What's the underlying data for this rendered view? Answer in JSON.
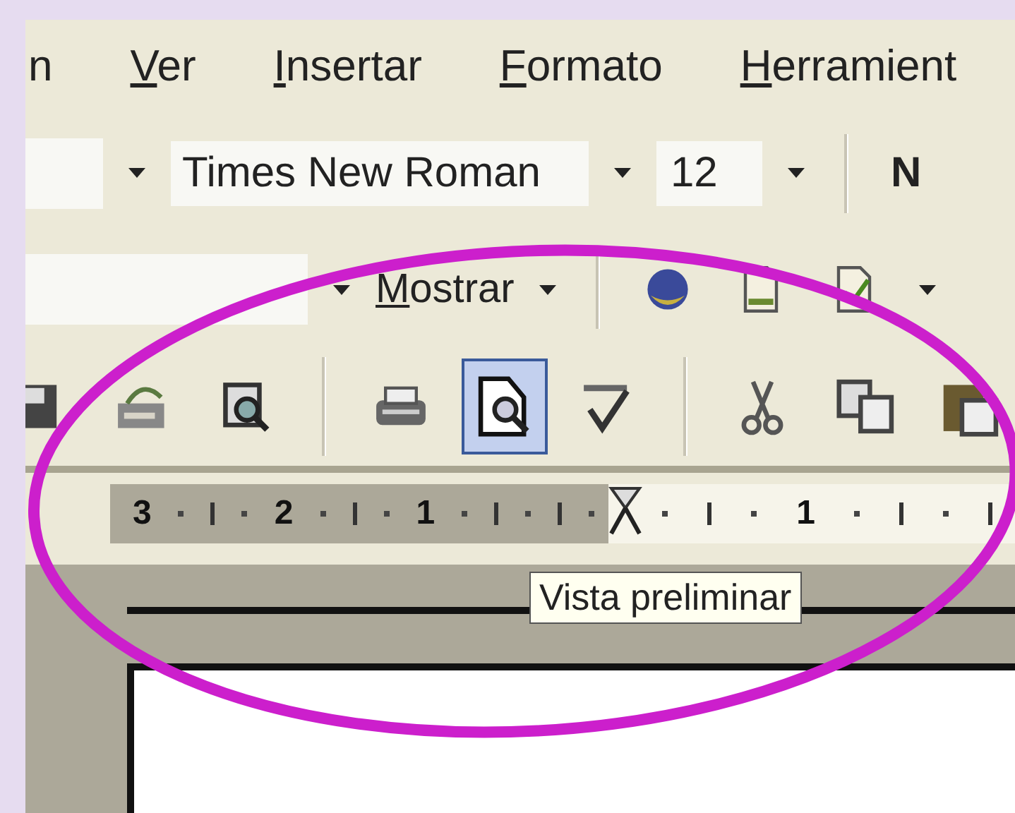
{
  "menu_bar": [
    {
      "rest": "n"
    },
    {
      "accel": "V",
      "rest": "er"
    },
    {
      "accel": "I",
      "rest": "nsertar"
    },
    {
      "accel": "F",
      "rest": "ormato"
    },
    {
      "accel": "H",
      "rest": "erramient"
    }
  ],
  "formatting_toolbar": {
    "font": "Times New Roman",
    "pt": "12",
    "bold": "N"
  },
  "reviewing_toolbar": {
    "accel": "M",
    "rest": "ostrar"
  },
  "review_tools": [
    {
      "kind": "globe"
    },
    {
      "kind": "doc"
    },
    {
      "kind": "track"
    }
  ],
  "standard_toolbar": [
    {
      "buttons": [
        {
          "kind": "disk",
          "selected": false
        },
        {
          "kind": "mail",
          "selected": false
        },
        {
          "kind": "research",
          "selected": false
        }
      ]
    },
    {
      "buttons": [
        {
          "kind": "print",
          "selected": false
        },
        {
          "kind": "preview",
          "selected": true
        },
        {
          "kind": "spelling",
          "selected": false
        }
      ]
    },
    {
      "buttons": [
        {
          "kind": "cut",
          "selected": false
        },
        {
          "kind": "copy",
          "selected": false
        },
        {
          "kind": "paste",
          "selected": false
        }
      ]
    }
  ],
  "ruler": {
    "left_numbers": [
      "3",
      "2",
      "1"
    ],
    "right_numbers": [
      "1"
    ]
  },
  "tooltip": "Vista preliminar"
}
